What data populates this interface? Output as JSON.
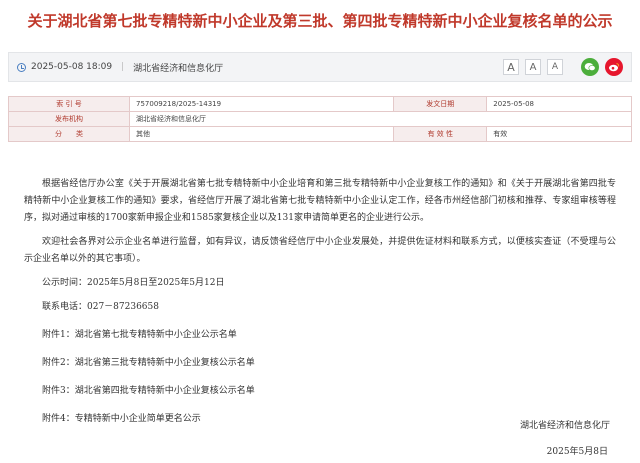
{
  "title": "关于湖北省第七批专精特新中小企业及第三批、第四批专精特新中小企业复核名单的公示",
  "meta": {
    "datetime": "2025-05-08 18:09",
    "source": "湖北省经济和信息化厅",
    "font_buttons": [
      "A",
      "A",
      "A"
    ],
    "share_icons": [
      "wechat-icon",
      "weibo-icon"
    ]
  },
  "info": {
    "index_label": "索 引 号",
    "index_value": "757009218/2025-14319",
    "date_label": "发文日期",
    "date_value": "2025-05-08",
    "org_label": "发布机构",
    "org_value": "湖北省经济和信息化厅",
    "category_label": "分　　类",
    "category_value": "其他",
    "validity_label": "有 效 性",
    "validity_value": "有效"
  },
  "body": {
    "para1": "根据省经信厅办公室《关于开展湖北省第七批专精特新中小企业培育和第三批专精特新中小企业复核工作的通知》和《关于开展湖北省第四批专精特新中小企业复核工作的通知》要求，省经信厅开展了湖北省第七批专精特新中小企业认定工作，经各市州经信部门初核和推荐、专家组审核等程序，拟对通过审核的1700家新申报企业和1585家复核企业以及131家申请简单更名的企业进行公示。",
    "para2": "欢迎社会各界对公示企业名单进行监督，如有异议，请反馈省经信厅中小企业发展处，并提供佐证材料和联系方式，以便核实查证（不受理与公示企业名单以外的其它事项）。",
    "period": "公示时间：2025年5月8日至2025年5月12日",
    "phone": "联系电话：027－87236658",
    "attachments": [
      "附件1：湖北省第七批专精特新中小企业公示名单",
      "附件2：湖北省第三批专精特新中小企业复核公示名单",
      "附件3：湖北省第四批专精特新中小企业复核公示名单",
      "附件4：专精特新中小企业简单更名公示"
    ],
    "signature": "湖北省经济和信息化厅",
    "sign_date": "2025年5月8日"
  }
}
